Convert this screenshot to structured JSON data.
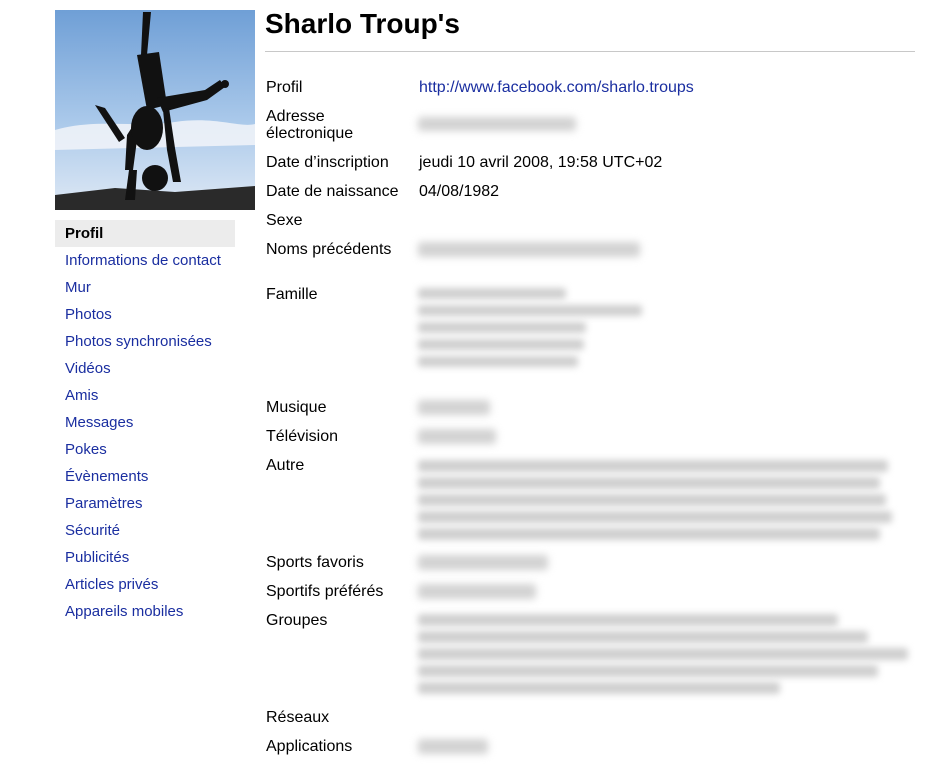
{
  "profile": {
    "title": "Sharlo Troup's",
    "photo_icon": "profile-photo-silhouette"
  },
  "nav": {
    "items": [
      {
        "label": "Profil",
        "active": true
      },
      {
        "label": "Informations de contact"
      },
      {
        "label": "Mur"
      },
      {
        "label": "Photos"
      },
      {
        "label": "Photos synchronisées"
      },
      {
        "label": "Vidéos"
      },
      {
        "label": "Amis"
      },
      {
        "label": "Messages"
      },
      {
        "label": "Pokes"
      },
      {
        "label": "Évènements"
      },
      {
        "label": "Paramètres"
      },
      {
        "label": "Sécurité"
      },
      {
        "label": "Publicités"
      },
      {
        "label": "Articles privés"
      },
      {
        "label": "Appareils mobiles"
      }
    ]
  },
  "fields": {
    "profil": {
      "label": "Profil",
      "value": "http://www.facebook.com/sharlo.troups"
    },
    "email": {
      "label": "Adresse électronique"
    },
    "inscription": {
      "label": "Date d’inscription",
      "value": "jeudi 10 avril 2008, 19:58 UTC+02"
    },
    "naissance": {
      "label": "Date de naissance",
      "value": "04/08/1982"
    },
    "sexe": {
      "label": "Sexe"
    },
    "noms": {
      "label": "Noms précédents"
    },
    "famille": {
      "label": "Famille"
    },
    "musique": {
      "label": "Musique"
    },
    "television": {
      "label": "Télévision"
    },
    "autre": {
      "label": "Autre"
    },
    "sports": {
      "label": "Sports favoris"
    },
    "sportifs": {
      "label": "Sportifs préférés"
    },
    "groupes": {
      "label": "Groupes"
    },
    "reseaux": {
      "label": "Réseaux"
    },
    "applications": {
      "label": "Applications"
    }
  },
  "colors": {
    "link": "#1a2ea0",
    "active_bg": "#ececec",
    "rule": "#c8c8c8"
  }
}
